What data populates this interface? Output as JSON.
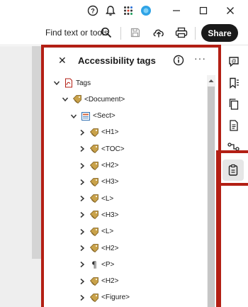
{
  "titlebar": {
    "icons": [
      "help-icon",
      "notification-bell-icon",
      "apps-grid-icon",
      "account-avatar-icon",
      "minimize-icon",
      "maximize-icon",
      "close-window-icon"
    ]
  },
  "toolbar": {
    "find_label": "Find text or tools",
    "share_label": "Share",
    "icons": [
      "search-icon",
      "save-icon",
      "upload-icon",
      "print-icon"
    ]
  },
  "panel": {
    "title": "Accessibility tags",
    "tree": [
      {
        "label": "Tags",
        "icon": "tags-root-icon",
        "expanded": true
      },
      {
        "label": "<Document>",
        "icon": "tag-icon",
        "expanded": true
      },
      {
        "label": "<Sect>",
        "icon": "section-icon",
        "expanded": true
      },
      {
        "label": "<H1>",
        "icon": "tag-icon",
        "expanded": false
      },
      {
        "label": "<TOC>",
        "icon": "tag-icon",
        "expanded": false
      },
      {
        "label": "<H2>",
        "icon": "tag-icon",
        "expanded": false
      },
      {
        "label": "<H3>",
        "icon": "tag-icon",
        "expanded": false
      },
      {
        "label": "<L>",
        "icon": "tag-icon",
        "expanded": false
      },
      {
        "label": "<H3>",
        "icon": "tag-icon",
        "expanded": false
      },
      {
        "label": "<L>",
        "icon": "tag-icon",
        "expanded": false
      },
      {
        "label": "<H2>",
        "icon": "tag-icon",
        "expanded": false
      },
      {
        "label": "<P>",
        "icon": "paragraph-icon",
        "expanded": false
      },
      {
        "label": "<H2>",
        "icon": "tag-icon",
        "expanded": false
      },
      {
        "label": "<Figure>",
        "icon": "tag-icon",
        "expanded": false
      }
    ]
  },
  "rail": {
    "icons": [
      "comment-icon",
      "bookmark-icon",
      "pages-icon",
      "attachment-icon",
      "order-icon",
      "accessibility-tags-icon"
    ]
  },
  "colors": {
    "highlight": "#b31f14",
    "tag_icon": "#c9a24a"
  }
}
